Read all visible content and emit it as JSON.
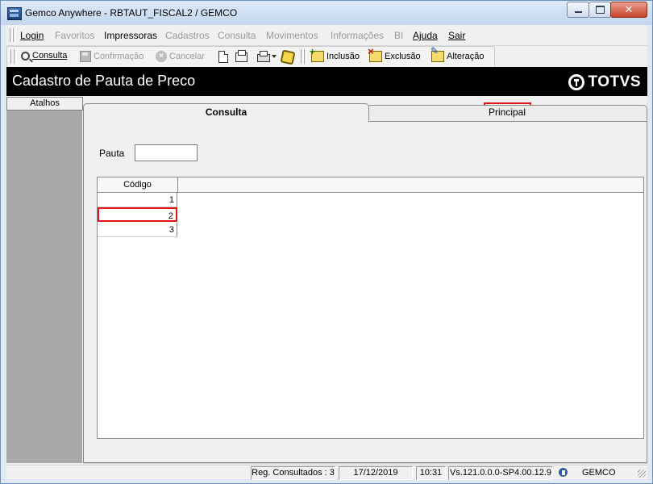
{
  "window": {
    "title": "Gemco Anywhere - RBTAUT_FISCAL2 / GEMCO"
  },
  "menu": [
    {
      "label": "Login",
      "enabled": true
    },
    {
      "label": "Favoritos",
      "enabled": false
    },
    {
      "label": "Impressoras",
      "enabled": true
    },
    {
      "label": "Cadastros",
      "enabled": false
    },
    {
      "label": "Consulta",
      "enabled": false
    },
    {
      "label": "Movimentos",
      "enabled": false
    },
    {
      "label": "Informações",
      "enabled": false
    },
    {
      "label": "BI",
      "enabled": false
    },
    {
      "label": "Ajuda",
      "enabled": true
    },
    {
      "label": "Sair",
      "enabled": true
    }
  ],
  "toolbar": {
    "consulta": "Consulta",
    "confirmacao": "Confirmação",
    "cancelar": "Cancelar",
    "inclusao": "Inclusão",
    "exclusao": "Exclusão",
    "alteracao": "Alteração"
  },
  "banner": {
    "title": "Cadastro de Pauta de Preco",
    "logo": "TOTVS"
  },
  "sidebar": {
    "header": "Atalhos"
  },
  "tabs": [
    {
      "label": "Consulta",
      "active": true
    },
    {
      "label": "Principal",
      "active": false
    }
  ],
  "form": {
    "pauta_label": "Pauta",
    "pauta_value": ""
  },
  "grid": {
    "columns": [
      "Código"
    ],
    "rows": [
      "1",
      "2",
      "3"
    ],
    "selected_row": "2"
  },
  "status": {
    "reg_consultados": "Reg. Consultados : 3",
    "date": "17/12/2019",
    "time": "10:31",
    "version": "Vs.121.0.0.0-SP4.00.12.9",
    "company": "GEMCO"
  },
  "colors": {
    "highlight": "#e1141a",
    "banner": "#000000",
    "sidebar": "#a9a9a9"
  }
}
